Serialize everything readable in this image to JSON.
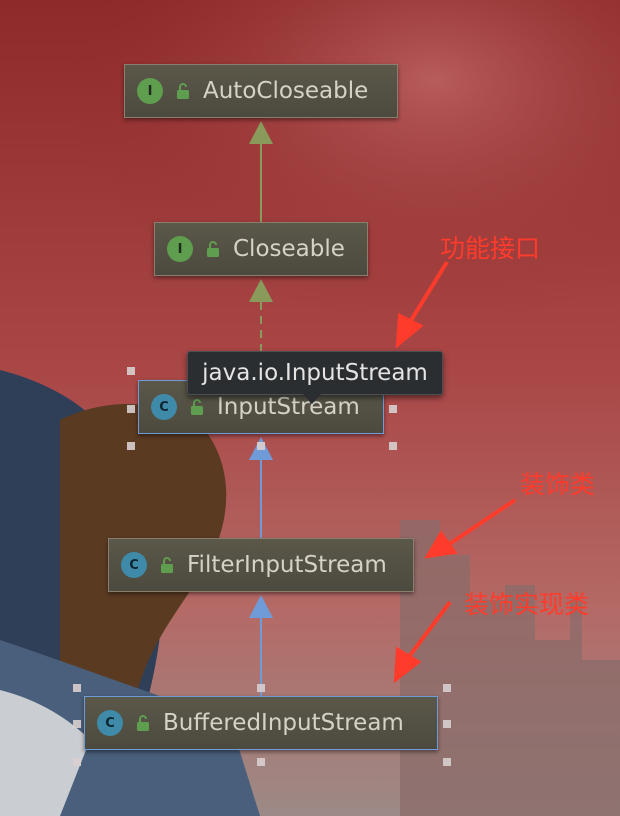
{
  "nodes": {
    "autocloseable": {
      "kind": "I",
      "label": "AutoCloseable"
    },
    "closeable": {
      "kind": "I",
      "label": "Closeable"
    },
    "inputstream": {
      "kind": "C",
      "label": "InputStream"
    },
    "filterinputstream": {
      "kind": "C",
      "label": "FilterInputStream"
    },
    "bufferedinputstream": {
      "kind": "C",
      "label": "BufferedInputStream"
    }
  },
  "tooltip": {
    "text": "java.io.InputStream"
  },
  "annotations": {
    "functional_interface": "功能接口",
    "decorator": "装饰类",
    "decorator_impl": "装饰实现类"
  },
  "colors": {
    "interface_badge": "#5f9d4f",
    "class_badge": "#3f8aa8",
    "interface_edge": "#8a9a5b",
    "class_edge": "#6f9bd8",
    "annotation": "#ff3b2b",
    "selection": "#6f9bd8"
  }
}
